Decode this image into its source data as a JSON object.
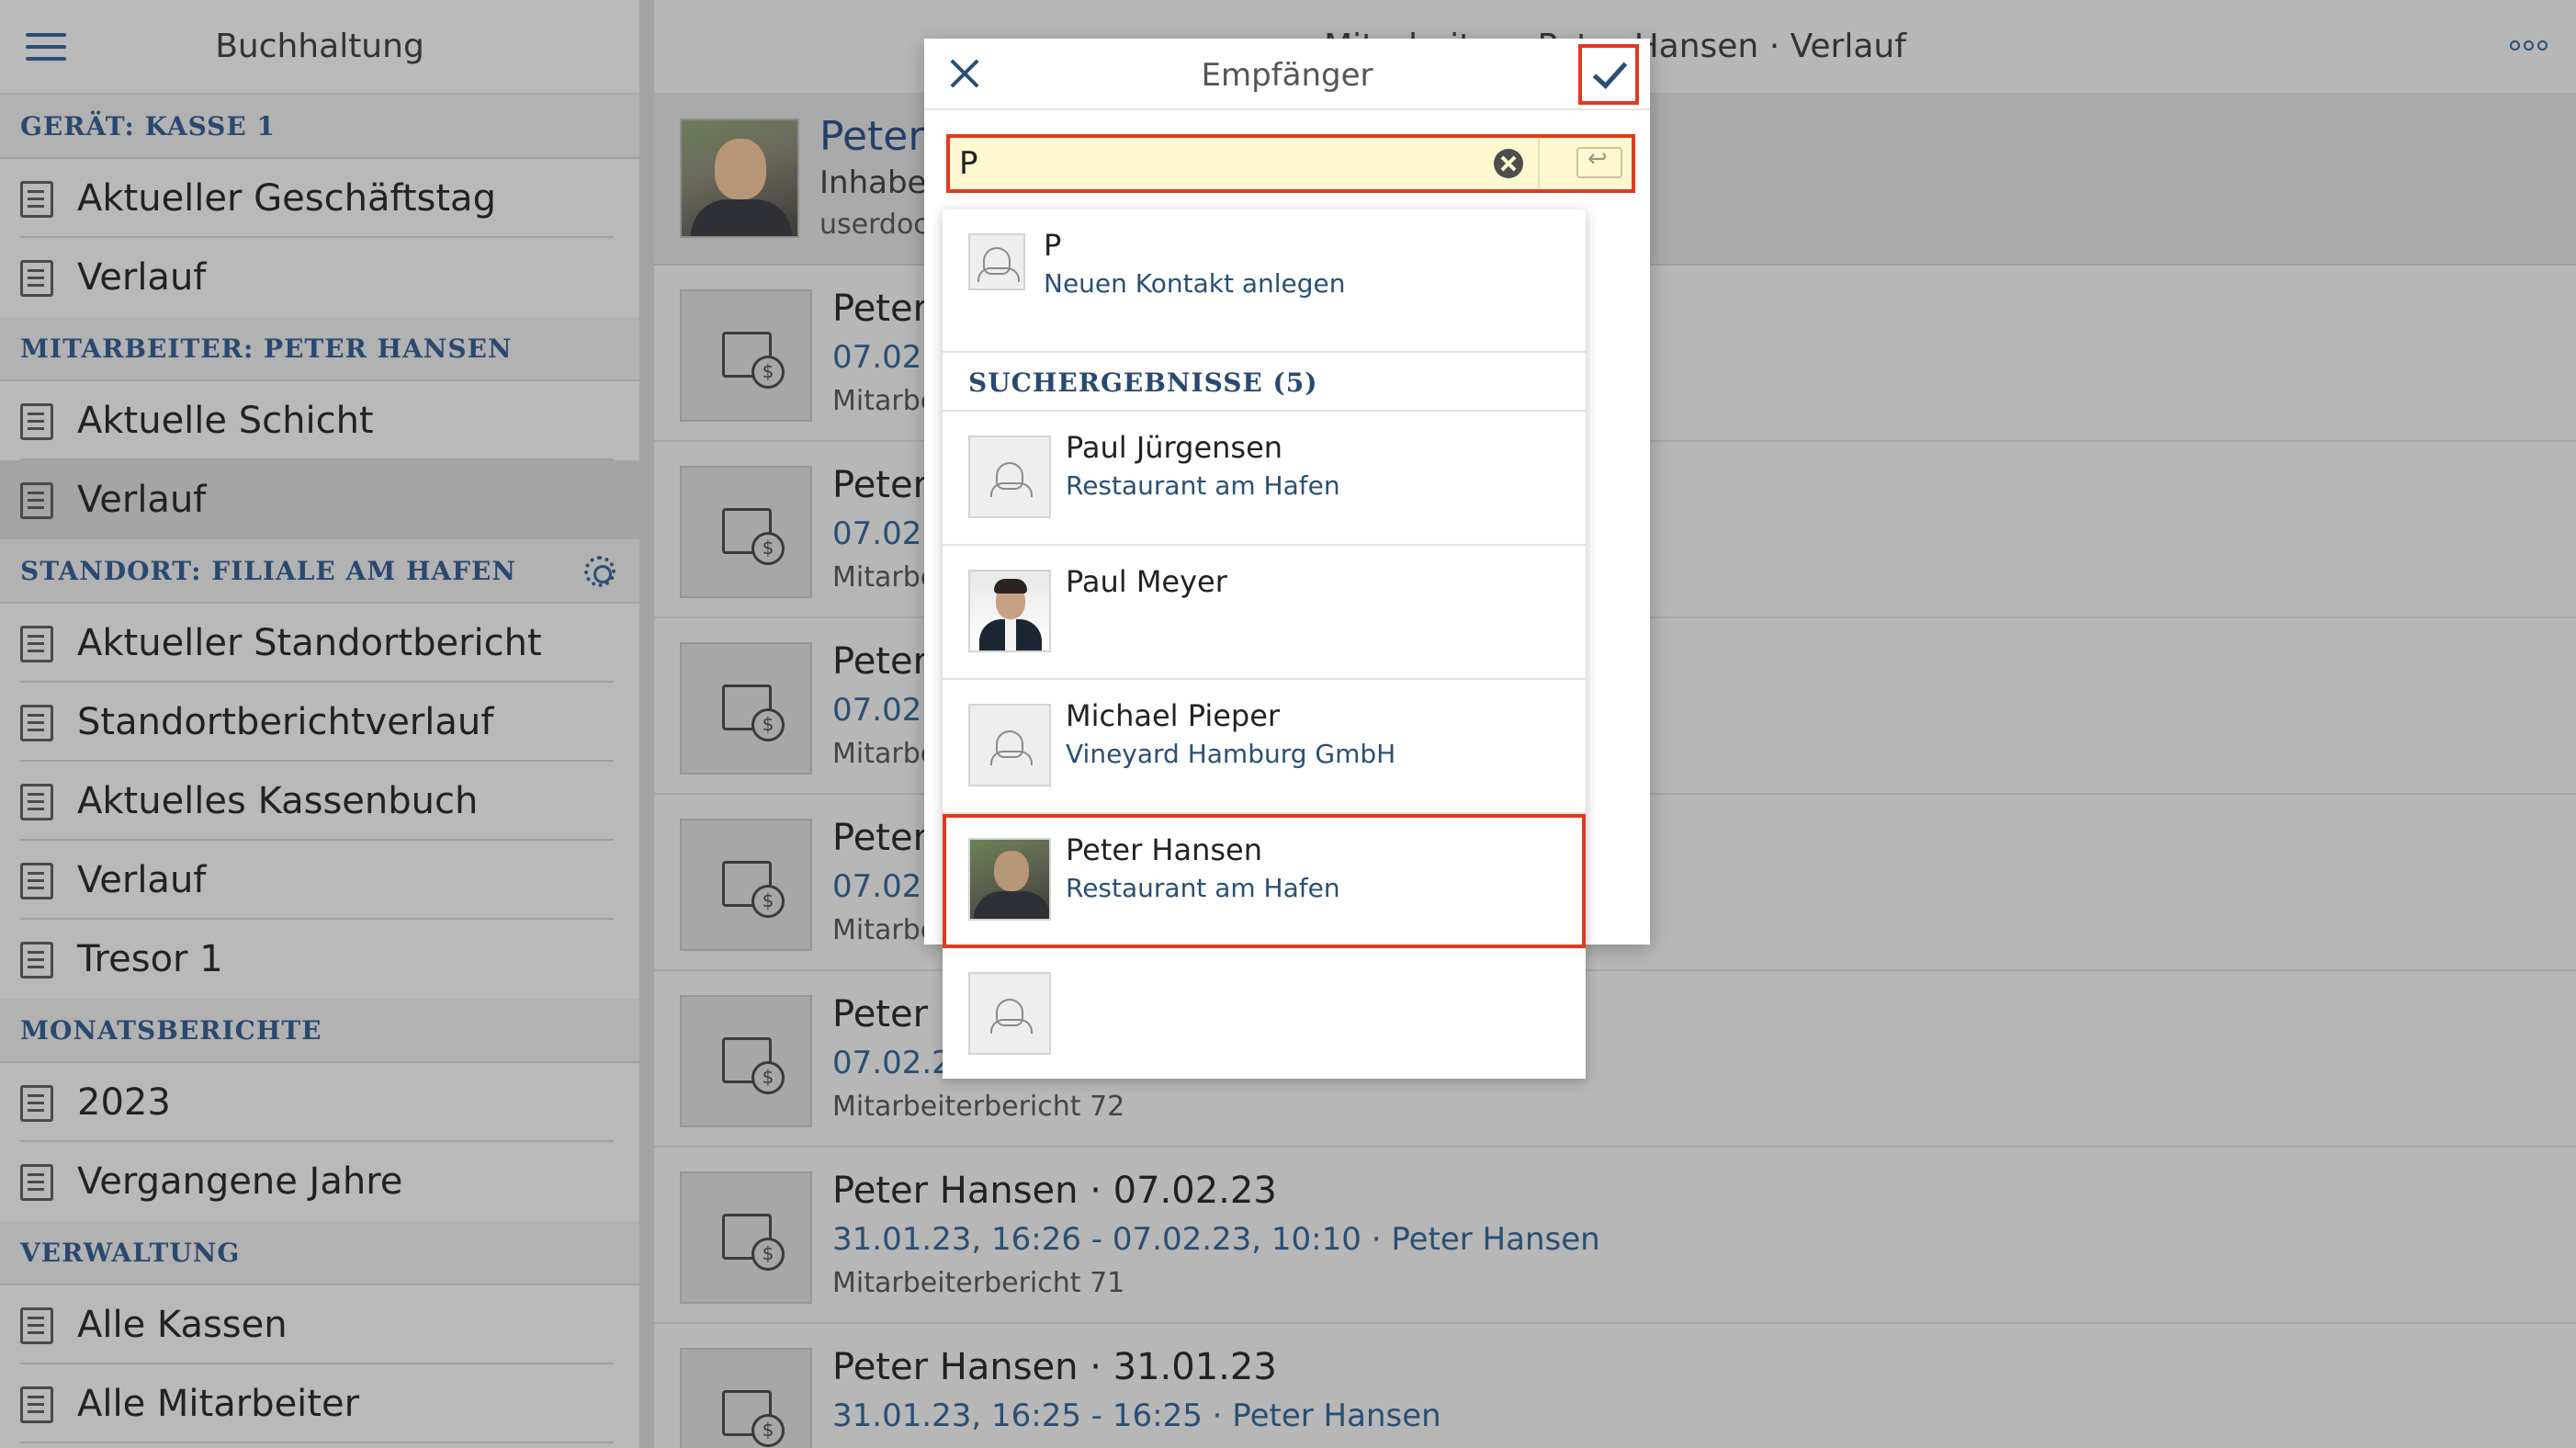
{
  "sidebar": {
    "title": "Buchhaltung",
    "sections": [
      {
        "header": "GERÄT: KASSE 1",
        "items": [
          {
            "label": "Aktueller Geschäftstag",
            "icon": "report-icon"
          },
          {
            "label": "Verlauf",
            "icon": "history-icon"
          }
        ]
      },
      {
        "header": "MITARBEITER: PETER HANSEN",
        "items": [
          {
            "label": "Aktuelle Schicht",
            "icon": "shift-icon"
          },
          {
            "label": "Verlauf",
            "icon": "history-icon",
            "active": true
          }
        ]
      },
      {
        "header": "STANDORT: FILIALE AM HAFEN",
        "has_settings": true,
        "items": [
          {
            "label": "Aktueller Standortbericht",
            "icon": "report-icon"
          },
          {
            "label": "Standortberichtverlauf",
            "icon": "history-icon"
          },
          {
            "label": "Aktuelles Kassenbuch",
            "icon": "cashbook-icon"
          },
          {
            "label": "Verlauf",
            "icon": "history-icon"
          },
          {
            "label": "Tresor 1",
            "icon": "safe-icon"
          }
        ]
      },
      {
        "header": "MONATSBERICHTE",
        "items": [
          {
            "label": "2023",
            "icon": "calendar-grid-icon"
          },
          {
            "label": "Vergangene Jahre",
            "icon": "history-icon"
          }
        ]
      },
      {
        "header": "VERWALTUNG",
        "items": [
          {
            "label": "Alle Kassen",
            "icon": "register-icon"
          },
          {
            "label": "Alle Mitarbeiter",
            "icon": "people-icon"
          }
        ]
      }
    ]
  },
  "main": {
    "title": "Mitarbeiter · Peter Hansen · Verlauf",
    "profile": {
      "name": "Peter H",
      "role": "Inhaber",
      "email": "userdoc+"
    },
    "reports": [
      {
        "title": "Peter",
        "sub": "07.02.",
        "meta": "Mitarbe"
      },
      {
        "title": "Peter",
        "sub": "07.02.",
        "meta": "Mitarbe"
      },
      {
        "title": "Peter",
        "sub": "07.02.",
        "meta": "Mitarbe"
      },
      {
        "title": "Peter",
        "sub": "07.02.",
        "meta": "Mitarbe"
      },
      {
        "title": "Peter H",
        "sub": "07.02.23",
        "meta": "Mitarbeiterbericht 72"
      },
      {
        "title": "Peter Hansen · 07.02.23",
        "sub": "31.01.23, 16:26 - 07.02.23, 10:10 · Peter Hansen",
        "meta": "Mitarbeiterbericht 71"
      },
      {
        "title": "Peter Hansen · 31.01.23",
        "sub": "31.01.23, 16:25 - 16:25 · Peter Hansen",
        "meta": ""
      }
    ]
  },
  "modal": {
    "title": "Empfänger",
    "search_value": "P",
    "new_contact": {
      "name": "P",
      "action": "Neuen Kontakt anlegen"
    },
    "results_header": "SUCHERGEBNISSE (5)",
    "results": [
      {
        "name": "Paul Jürgensen",
        "company": "Restaurant am Hafen",
        "avatar": "placeholder"
      },
      {
        "name": "Paul Meyer",
        "company": "",
        "avatar": "photo-suit"
      },
      {
        "name": "Michael Pieper",
        "company": "Vineyard Hamburg GmbH",
        "avatar": "placeholder"
      },
      {
        "name": "Peter Hansen",
        "company": "Restaurant am Hafen",
        "avatar": "photo-outdoor",
        "selected": true
      },
      {
        "name": "",
        "company": "",
        "avatar": "placeholder"
      }
    ]
  },
  "colors": {
    "accent": "#2a4f74",
    "highlight": "#e03a1f",
    "search_bg": "#fdf8cf"
  }
}
